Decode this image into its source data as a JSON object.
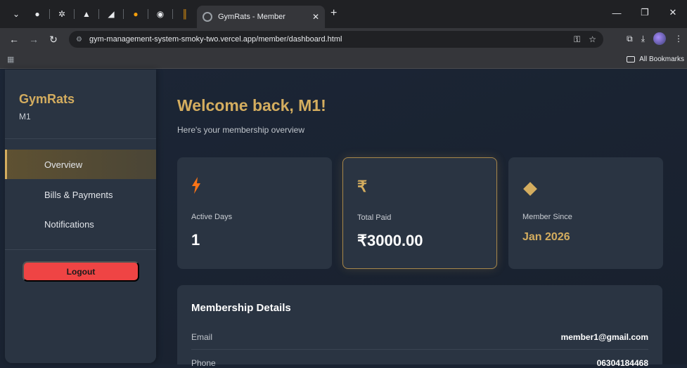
{
  "browser": {
    "tab_title": "GymRats - Member",
    "url": "gym-management-system-smoky-two.vercel.app/member/dashboard.html",
    "bookmarks_label": "All Bookmarks"
  },
  "sidebar": {
    "brand": "GymRats",
    "user": "M1",
    "items": [
      {
        "label": "Overview",
        "active": true
      },
      {
        "label": "Bills & Payments",
        "active": false
      },
      {
        "label": "Notifications",
        "active": false
      }
    ],
    "logout_label": "Logout"
  },
  "main": {
    "welcome": "Welcome back, M1!",
    "subtitle": "Here's your membership overview",
    "cards": [
      {
        "icon": "lightning-bolt-icon",
        "label": "Active Days",
        "value": "1"
      },
      {
        "icon": "rupee-icon",
        "label": "Total Paid",
        "value": "₹3000.00"
      },
      {
        "icon": "diamond-icon",
        "label": "Member Since",
        "value": "Jan 2026"
      }
    ],
    "details": {
      "title": "Membership Details",
      "rows": [
        {
          "key": "Email",
          "value": "member1@gmail.com"
        },
        {
          "key": "Phone",
          "value": "06304184468"
        }
      ]
    }
  },
  "colors": {
    "accent": "#d4ad5f",
    "logout": "#ef4444",
    "bolt": "#f97316"
  }
}
